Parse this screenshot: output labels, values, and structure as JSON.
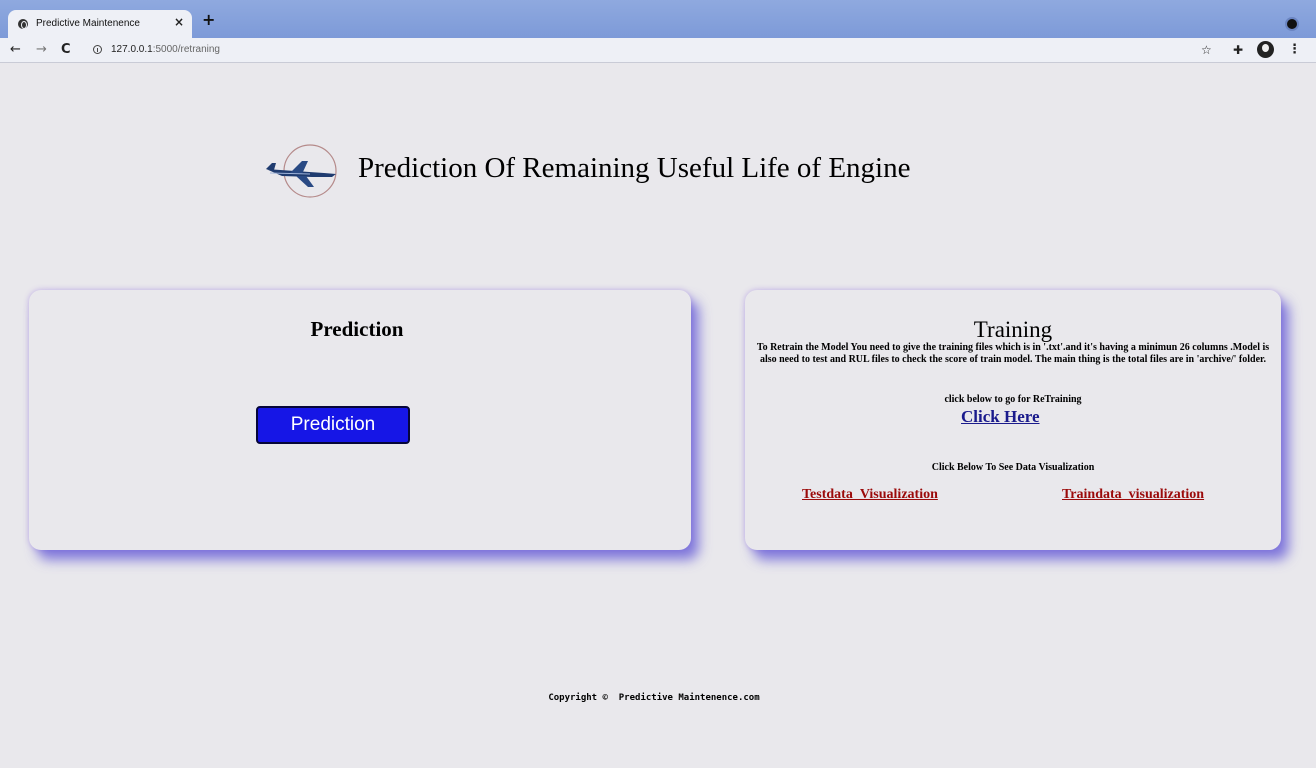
{
  "browser": {
    "tab_title": "Predictive Maintenence",
    "tab_close": "×",
    "new_tab": "+",
    "url_host": "127.0.0.1",
    "url_rest": ":5000/retraning",
    "icons": [
      "globe-icon",
      "back-icon",
      "forward-icon",
      "reload-icon",
      "info-icon",
      "star-icon",
      "extensions-icon",
      "avatar",
      "menu-icon"
    ]
  },
  "header": {
    "title": "Prediction Of Remaining Useful Life of Engine"
  },
  "prediction_card": {
    "heading": "Prediction",
    "button_label": "Prediction"
  },
  "training_card": {
    "heading": "Training",
    "description": "To Retrain the Model You need to give the training files which is in '.txt'.and it's having a minimun 26 columns .Model is also need to test and RUL files to check the score of train model. The main thing is the total files are in 'archive/' folder.",
    "retrain_label": "click below to go for ReTraining",
    "retrain_link": "Click Here",
    "viz_label": "Click Below To See Data Visualization",
    "test_viz_link": "Testdata_Visualization",
    "train_viz_link": "Traindata_visualization"
  },
  "footer": {
    "copyright": "Copyright ©  Predictive Maintenence.com"
  },
  "colors": {
    "page_bg": "#e9e8ec",
    "button_blue": "#1616e6",
    "link_blue": "#1a1a8c",
    "link_red": "#9b0a0a",
    "card_shadow": "#6056d6"
  }
}
